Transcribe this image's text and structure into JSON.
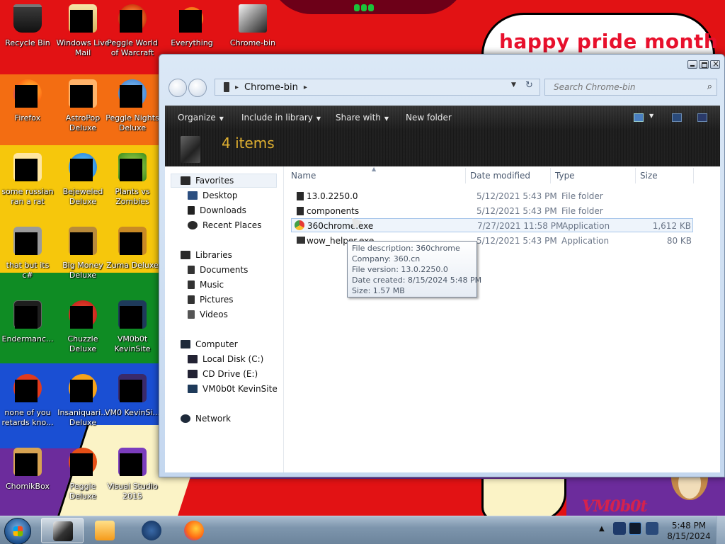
{
  "desktop": {
    "wallpaper_text": "happy pride month",
    "wallpaper_signature": "VM0b0t",
    "colors": {
      "red": "#e21214",
      "orange": "#f36d12",
      "yellow": "#f6c70c",
      "green": "#0f8c24",
      "blue": "#1a4fd3",
      "purple": "#6c2c9c"
    },
    "icons": [
      {
        "label": "Recycle Bin",
        "icon": "recycle-bin-icon"
      },
      {
        "label": "Windows Live Mail",
        "icon": "mail-icon"
      },
      {
        "label": "Peggle World of Warcraft",
        "icon": "peggle-icon"
      },
      {
        "label": "Everything",
        "icon": "search-icon"
      },
      {
        "label": "Chrome-bin",
        "icon": "folder-icon"
      },
      {
        "label": "Firefox",
        "icon": "firefox-icon"
      },
      {
        "label": "AstroPop Deluxe",
        "icon": "game-icon"
      },
      {
        "label": "Peggle Nights Deluxe",
        "icon": "game-icon"
      },
      {
        "label": "some russian ran a rat",
        "icon": "app-icon"
      },
      {
        "label": "Bejeweled Deluxe",
        "icon": "game-icon"
      },
      {
        "label": "Plants vs Zombies",
        "icon": "game-icon"
      },
      {
        "label": "that but its c#",
        "icon": "app-icon"
      },
      {
        "label": "Big Money Deluxe",
        "icon": "game-icon"
      },
      {
        "label": "Zuma Deluxe",
        "icon": "game-icon"
      },
      {
        "label": "Endermanc...",
        "icon": "app-icon"
      },
      {
        "label": "Chuzzle Deluxe",
        "icon": "game-icon"
      },
      {
        "label": "VM0b0t KevinSite",
        "icon": "app-icon"
      },
      {
        "label": "none of you retards kno...",
        "icon": "app-icon"
      },
      {
        "label": "Insaniquari... Deluxe",
        "icon": "game-icon"
      },
      {
        "label": "VM0 KevinSi...",
        "icon": "app-icon"
      },
      {
        "label": "ChomikBox",
        "icon": "app-icon"
      },
      {
        "label": "Peggle Deluxe",
        "icon": "game-icon"
      },
      {
        "label": "Visual Studio 2015",
        "icon": "visual-studio-icon"
      }
    ]
  },
  "explorer": {
    "address": {
      "crumb": "Chrome-bin"
    },
    "search": {
      "placeholder": "Search Chrome-bin"
    },
    "toolbar": {
      "organize": "Organize",
      "include_in_library": "Include in library",
      "share_with": "Share with",
      "new_folder": "New folder"
    },
    "items_count": "4 items",
    "nav": {
      "favorites": "Favorites",
      "desktop": "Desktop",
      "downloads": "Downloads",
      "recent_places": "Recent Places",
      "libraries": "Libraries",
      "documents": "Documents",
      "music": "Music",
      "pictures": "Pictures",
      "videos": "Videos",
      "computer": "Computer",
      "local_disk": "Local Disk (C:)",
      "cd_drive": "CD Drive (E:)",
      "kevinsite": "VM0b0t KevinSite",
      "network": "Network"
    },
    "columns": {
      "name": "Name",
      "date": "Date modified",
      "type": "Type",
      "size": "Size"
    },
    "files": [
      {
        "name": "13.0.2250.0",
        "date": "5/12/2021 5:43 PM",
        "type": "File folder",
        "size": ""
      },
      {
        "name": "components",
        "date": "5/12/2021 5:43 PM",
        "type": "File folder",
        "size": ""
      },
      {
        "name": "360chrome.exe",
        "date": "7/27/2021 11:58 PM",
        "type": "Application",
        "size": "1,612 KB"
      },
      {
        "name": "wow_helper.exe",
        "date": "5/12/2021 5:43 PM",
        "type": "Application",
        "size": "80 KB"
      }
    ],
    "tooltip": {
      "description": "File description: 360chrome",
      "company": "Company: 360.cn",
      "version": "File version: 13.0.2250.0",
      "created": "Date created: 8/15/2024 5:48 PM",
      "size": "Size: 1.57 MB"
    }
  },
  "taskbar": {
    "clock_time": "5:48 PM",
    "clock_date": "8/15/2024"
  }
}
